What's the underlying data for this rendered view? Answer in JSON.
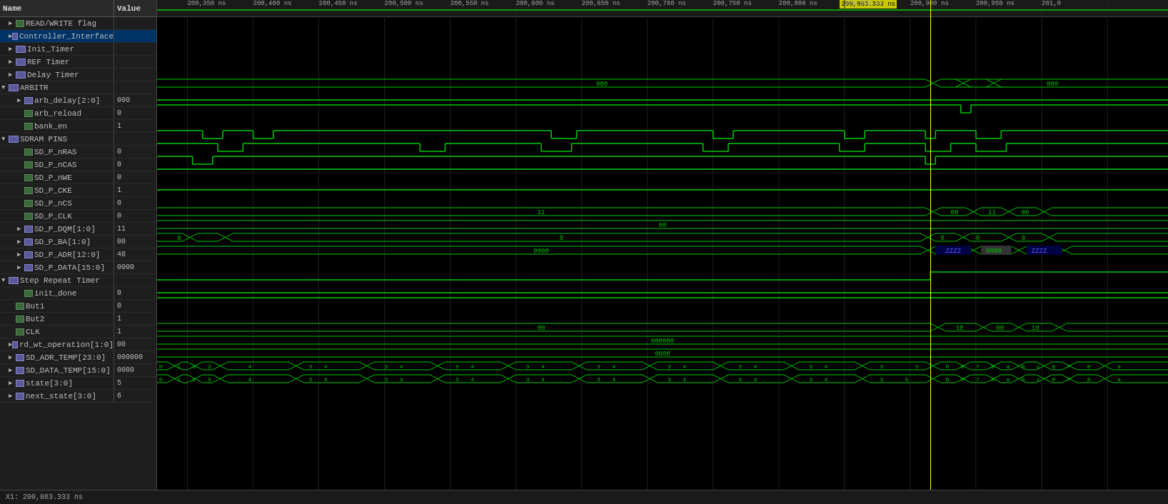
{
  "header": {
    "name_col": "Name",
    "value_col": "Value"
  },
  "cursor": {
    "label": "200,863.333 ns",
    "x_position_pct": 76.5
  },
  "status": {
    "x1_label": "X1: 200,863.333 ns"
  },
  "timeline": {
    "ticks": [
      {
        "label": "200,350 ns",
        "pct": 3
      },
      {
        "label": "200,400 ns",
        "pct": 9.5
      },
      {
        "label": "200,450 ns",
        "pct": 16
      },
      {
        "label": "200,500 ns",
        "pct": 22.5
      },
      {
        "label": "200,550 ns",
        "pct": 29
      },
      {
        "label": "200,600 ns",
        "pct": 35.5
      },
      {
        "label": "200,650 ns",
        "pct": 42
      },
      {
        "label": "200,700 ns",
        "pct": 48.5
      },
      {
        "label": "200,750 ns",
        "pct": 55
      },
      {
        "label": "200,800 ns",
        "pct": 61.5
      },
      {
        "label": "200,850 ns",
        "pct": 68
      },
      {
        "label": "200,900 ns",
        "pct": 74.5
      },
      {
        "label": "200,950 ns",
        "pct": 81
      },
      {
        "label": "201,0",
        "pct": 87.5
      }
    ]
  },
  "signals": [
    {
      "id": "read_write_flag",
      "name": "READ/WRITE flag",
      "value": "",
      "indent": 1,
      "type": "signal",
      "expandable": true
    },
    {
      "id": "controller_interface",
      "name": "Controller_Interface",
      "value": "",
      "indent": 1,
      "type": "group",
      "expandable": true,
      "selected": true
    },
    {
      "id": "init_timer",
      "name": "Init_Timer",
      "value": "",
      "indent": 1,
      "type": "group",
      "expandable": true
    },
    {
      "id": "ref_timer",
      "name": "REF Timer",
      "value": "",
      "indent": 1,
      "type": "group",
      "expandable": true
    },
    {
      "id": "delay_timer",
      "name": "Delay Timer",
      "value": "",
      "indent": 1,
      "type": "group",
      "expandable": true
    },
    {
      "id": "arbitr",
      "name": "ARBITR",
      "value": "",
      "indent": 0,
      "type": "group",
      "expandable": true,
      "expanded": true
    },
    {
      "id": "arb_delay",
      "name": "arb_delay[2:0]",
      "value": "000",
      "indent": 2,
      "type": "bus",
      "expandable": true
    },
    {
      "id": "arb_reload",
      "name": "arb_reload",
      "value": "0",
      "indent": 2,
      "type": "signal"
    },
    {
      "id": "bank_en",
      "name": "bank_en",
      "value": "1",
      "indent": 2,
      "type": "signal"
    },
    {
      "id": "sdram_pins",
      "name": "SDRAM PINS",
      "value": "",
      "indent": 0,
      "type": "group",
      "expandable": true,
      "expanded": true
    },
    {
      "id": "sd_p_nras",
      "name": "SD_P_nRAS",
      "value": "0",
      "indent": 2,
      "type": "signal"
    },
    {
      "id": "sd_p_ncas",
      "name": "SD_P_nCAS",
      "value": "0",
      "indent": 2,
      "type": "signal"
    },
    {
      "id": "sd_p_nwe",
      "name": "SD_P_nWE",
      "value": "0",
      "indent": 2,
      "type": "signal"
    },
    {
      "id": "sd_p_cke",
      "name": "SD_P_CKE",
      "value": "1",
      "indent": 2,
      "type": "signal"
    },
    {
      "id": "sd_p_ncs",
      "name": "SD_P_nCS",
      "value": "0",
      "indent": 2,
      "type": "signal"
    },
    {
      "id": "sd_p_clk",
      "name": "SD_P_CLK",
      "value": "0",
      "indent": 2,
      "type": "signal"
    },
    {
      "id": "sd_p_dqm",
      "name": "SD_P_DQM[1:0]",
      "value": "11",
      "indent": 2,
      "type": "bus",
      "expandable": true
    },
    {
      "id": "sd_p_ba",
      "name": "SD_P_BA[1:0]",
      "value": "00",
      "indent": 2,
      "type": "bus",
      "expandable": true
    },
    {
      "id": "sd_p_adr",
      "name": "SD_P_ADR[12:0]",
      "value": "48",
      "indent": 2,
      "type": "bus",
      "expandable": true
    },
    {
      "id": "sd_p_data",
      "name": "SD_P_DATA[15:0]",
      "value": "0000",
      "indent": 2,
      "type": "bus",
      "expandable": true
    },
    {
      "id": "step_repeat_timer",
      "name": "Step Repeat Timer",
      "value": "",
      "indent": 0,
      "type": "group",
      "expandable": true,
      "expanded": true
    },
    {
      "id": "init_done",
      "name": "init_done",
      "value": "0",
      "indent": 2,
      "type": "signal"
    },
    {
      "id": "but1",
      "name": "But1",
      "value": "0",
      "indent": 1,
      "type": "signal"
    },
    {
      "id": "but2",
      "name": "But2",
      "value": "1",
      "indent": 1,
      "type": "signal"
    },
    {
      "id": "clk",
      "name": "CLK",
      "value": "1",
      "indent": 1,
      "type": "signal"
    },
    {
      "id": "rd_wt_operation",
      "name": "rd_wt_operation[1:0]",
      "value": "00",
      "indent": 1,
      "type": "bus",
      "expandable": true
    },
    {
      "id": "sd_adr_temp",
      "name": "SD_ADR_TEMP[23:0]",
      "value": "000000",
      "indent": 1,
      "type": "bus",
      "expandable": true
    },
    {
      "id": "sd_data_temp",
      "name": "SD_DATA_TEMP[15:0]",
      "value": "0000",
      "indent": 1,
      "type": "bus",
      "expandable": true
    },
    {
      "id": "state",
      "name": "state[3:0]",
      "value": "5",
      "indent": 1,
      "type": "bus",
      "expandable": true
    },
    {
      "id": "next_state",
      "name": "next_state[3:0]",
      "value": "6",
      "indent": 1,
      "type": "bus",
      "expandable": true
    }
  ]
}
